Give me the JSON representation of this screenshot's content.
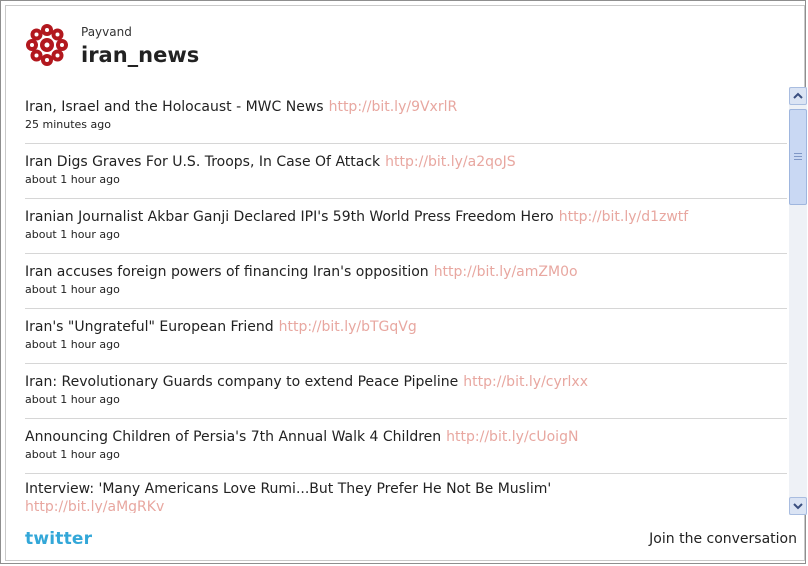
{
  "profile": {
    "name": "Payvand",
    "handle": "iran_news",
    "logo_color": "#b2181e"
  },
  "tweets": [
    {
      "text": "Iran, Israel and the Holocaust - MWC News",
      "link": "http://bit.ly/9VxrlR",
      "time": "25 minutes ago"
    },
    {
      "text": "Iran Digs Graves For U.S. Troops, In Case Of Attack",
      "link": "http://bit.ly/a2qoJS",
      "time": "about 1 hour ago"
    },
    {
      "text": "Iranian Journalist Akbar Ganji Declared IPI's 59th World Press Freedom Hero",
      "link": "http://bit.ly/d1zwtf",
      "time": "about 1 hour ago"
    },
    {
      "text": "Iran accuses foreign powers of financing Iran's opposition",
      "link": "http://bit.ly/amZM0o",
      "time": "about 1 hour ago"
    },
    {
      "text": "Iran's \"Ungrateful\" European Friend",
      "link": "http://bit.ly/bTGqVg",
      "time": "about 1 hour ago"
    },
    {
      "text": "Iran: Revolutionary Guards company to extend Peace Pipeline",
      "link": "http://bit.ly/cyrlxx",
      "time": "about 1 hour ago"
    },
    {
      "text": "Announcing Children of Persia's 7th Annual Walk 4 Children",
      "link": "http://bit.ly/cUoigN",
      "time": "about 1 hour ago"
    },
    {
      "text": "Interview: 'Many Americans Love Rumi...But They Prefer He Not Be Muslim'",
      "link": "http://bit.ly/aMgRKv",
      "time": ""
    }
  ],
  "footer": {
    "brand": "twitter",
    "join_label": "Join the conversation"
  },
  "colors": {
    "link": "#e8a7a0",
    "brand": "#33a7d8"
  }
}
